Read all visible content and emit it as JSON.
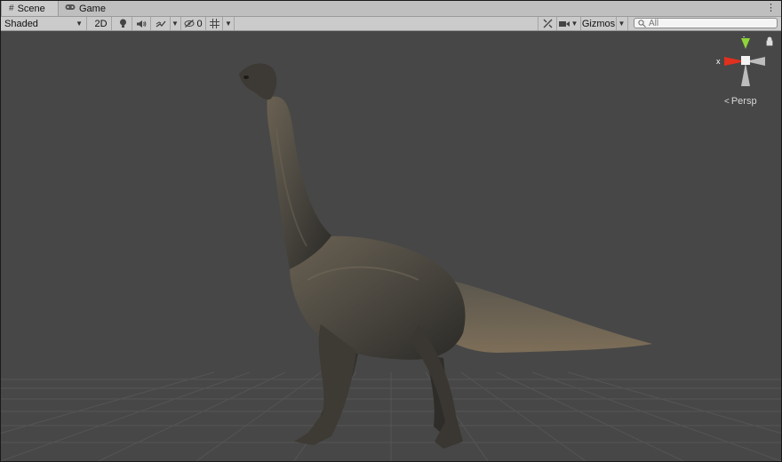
{
  "tabs": [
    {
      "label": "Scene",
      "icon": "grid-icon",
      "active": true
    },
    {
      "label": "Game",
      "icon": "gamepad-icon",
      "active": false
    }
  ],
  "toolbar": {
    "shading_mode": "Shaded",
    "mode_2d": "2D",
    "hidden_count": "0",
    "gizmos_label": "Gizmos",
    "search_placeholder": "All"
  },
  "scene_gizmo": {
    "x_label": "x",
    "y_label": "y",
    "projection_label": "Persp"
  },
  "colors": {
    "tab_bar": "#bfbfbf",
    "toolbar": "#cbcbcb",
    "viewport": "#474747",
    "axis_x": "#e0301e",
    "axis_y": "#8fd43a"
  },
  "scene_object": "brachiosaurus-model"
}
